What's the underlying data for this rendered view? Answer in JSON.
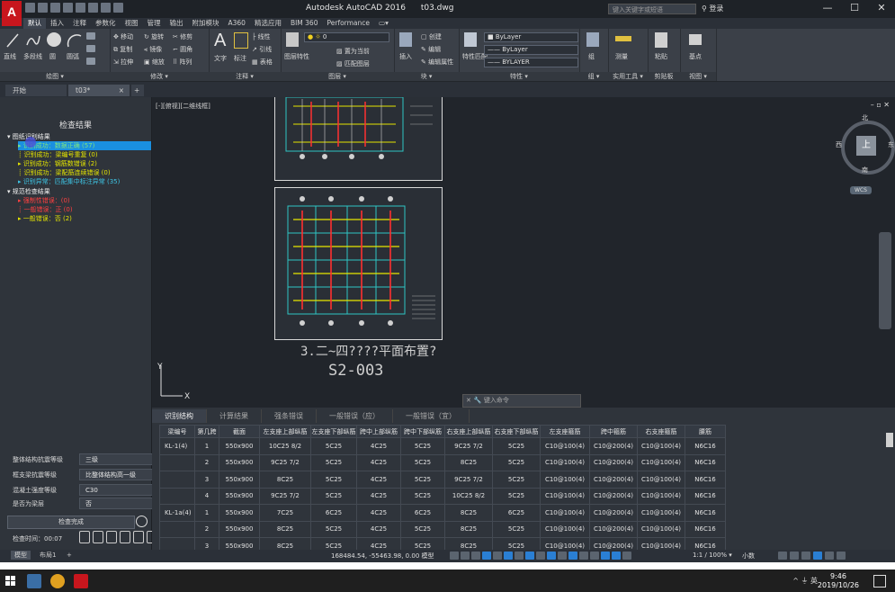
{
  "window": {
    "title": "Autodesk AutoCAD 2016",
    "filename": "t03.dwg",
    "search_placeholder": "键入关键字或短语",
    "signin": "登录",
    "min": "—",
    "max": "☐",
    "close": "✕"
  },
  "menu_tabs": [
    "默认",
    "插入",
    "注释",
    "参数化",
    "视图",
    "管理",
    "输出",
    "附加模块",
    "A360",
    "精选应用",
    "BIM 360",
    "Performance",
    "▭▾"
  ],
  "ribbon": {
    "panels": {
      "draw": "绘图 ▾",
      "modify": "修改 ▾",
      "annotation": "注释 ▾",
      "layers": "图层 ▾",
      "block": "块 ▾",
      "properties": "特性 ▾",
      "groups": "组 ▾",
      "utilities": "实用工具 ▾",
      "clipboard": "剪贴板",
      "view": "视图 ▾"
    },
    "tools": {
      "line": "直线",
      "polyline": "多段线",
      "circle": "圆",
      "arc": "圆弧",
      "move": "移动",
      "rotate": "旋转",
      "trim": "修剪",
      "copy": "复制",
      "mirror": "镜像",
      "fillet": "圆角",
      "stretch": "拉伸",
      "scale": "缩放",
      "array": "阵列",
      "text": "文字",
      "dimension": "标注",
      "linear": "线性",
      "leader": "引线",
      "table": "表格",
      "layer_props": "图层特性",
      "layer_current": "置为当前",
      "match_layer": "匹配图层",
      "insert": "插入",
      "create": "创建",
      "edit": "编辑",
      "edit_attr": "编辑属性",
      "match_props": "特性匹配",
      "group": "组",
      "measure": "测量",
      "paste": "粘贴",
      "base": "基点",
      "layer_value": "0"
    },
    "bylayer1": "ByLayer",
    "bylayer2": "ByLayer",
    "bylayer3": "BYLAYER"
  },
  "file_tabs": {
    "start": "开始",
    "current": "t03*",
    "close": "×",
    "add": "+"
  },
  "left_panel": {
    "title": "检查结果",
    "tree": [
      {
        "text": "▾ 图纸识别结果",
        "color": "#f0f0f0",
        "indent": 0
      },
      {
        "text": "▸ 识别成功：数据正确 (57)",
        "color": "#7fe37f",
        "indent": 1,
        "selected": true
      },
      {
        "text": "┊ 识别成功：梁编号重复 (0)",
        "color": "#e6e600",
        "indent": 1
      },
      {
        "text": "▸ 识别成功：钢筋数错误 (2)",
        "color": "#e6e600",
        "indent": 1
      },
      {
        "text": "┊ 识别成功：梁配筋连续错误 (0)",
        "color": "#e6e600",
        "indent": 1
      },
      {
        "text": "▸ 识别异常：匹配集中标注异常 (35)",
        "color": "#3ec6e6",
        "indent": 1
      },
      {
        "text": "▾ 规范检查结果",
        "color": "#f0f0f0",
        "indent": 0
      },
      {
        "text": "▸ 强制性错误：(0)",
        "color": "#ff4040",
        "indent": 1
      },
      {
        "text": "┊ 一般错误：正 (0)",
        "color": "#ff4040",
        "indent": 1
      },
      {
        "text": "▸ 一般错误：否 (2)",
        "color": "#e6e600",
        "indent": 1
      }
    ],
    "fields": [
      {
        "label": "整体结构抗震等级",
        "value": "三级"
      },
      {
        "label": "框支梁抗震等级",
        "value": "比整体结构高一级"
      },
      {
        "label": "混凝土强度等级",
        "value": "C30"
      },
      {
        "label": "是否为梁层",
        "value": "否"
      }
    ],
    "check_button": "检查完成",
    "check_time": "检查时间：00:07"
  },
  "drawing": {
    "view_label": "[-][俯视][二维线框]",
    "caption": "3.二~四????平面布置?",
    "code": "S2-003",
    "viewcube": {
      "north": "北",
      "south": "南",
      "east": "东",
      "west": "西",
      "top": "上"
    },
    "wcs": "WCS",
    "command_placeholder": "键入命令",
    "win_controls": "– ▫ ✕"
  },
  "results_table": {
    "tabs": [
      "识别结构",
      "计算结果",
      "强条错误",
      "一般错误（应）",
      "一般错误（宜）"
    ],
    "headers": [
      "梁编号",
      "第几跨",
      "截面",
      "左支座上部纵筋",
      "左支座下部纵筋",
      "跨中上部纵筋",
      "跨中下部纵筋",
      "右支座上部纵筋",
      "右支座下部纵筋",
      "左支座箍筋",
      "跨中箍筋",
      "右支座箍筋",
      "腰筋"
    ],
    "rows": [
      [
        "KL-1(4)",
        "1",
        "550x900",
        "10C25 8/2",
        "5C25",
        "4C25",
        "5C25",
        "9C25 7/2",
        "5C25",
        "C10@100(4)",
        "C10@200(4)",
        "C10@100(4)",
        "N6C16"
      ],
      [
        "",
        "2",
        "550x900",
        "9C25 7/2",
        "5C25",
        "4C25",
        "5C25",
        "8C25",
        "5C25",
        "C10@100(4)",
        "C10@200(4)",
        "C10@100(4)",
        "N6C16"
      ],
      [
        "",
        "3",
        "550x900",
        "8C25",
        "5C25",
        "4C25",
        "5C25",
        "9C25 7/2",
        "5C25",
        "C10@100(4)",
        "C10@200(4)",
        "C10@100(4)",
        "N6C16"
      ],
      [
        "",
        "4",
        "550x900",
        "9C25 7/2",
        "5C25",
        "4C25",
        "5C25",
        "10C25 8/2",
        "5C25",
        "C10@100(4)",
        "C10@200(4)",
        "C10@100(4)",
        "N6C16"
      ],
      [
        "KL-1a(4)",
        "1",
        "550x900",
        "7C25",
        "6C25",
        "4C25",
        "6C25",
        "8C25",
        "6C25",
        "C10@100(4)",
        "C10@200(4)",
        "C10@100(4)",
        "N6C16"
      ],
      [
        "",
        "2",
        "550x900",
        "8C25",
        "5C25",
        "4C25",
        "5C25",
        "8C25",
        "5C25",
        "C10@100(4)",
        "C10@200(4)",
        "C10@100(4)",
        "N6C16"
      ],
      [
        "",
        "3",
        "550x900",
        "8C25",
        "5C25",
        "4C25",
        "5C25",
        "8C25",
        "5C25",
        "C10@100(4)",
        "C10@200(4)",
        "C10@100(4)",
        "N6C16"
      ]
    ]
  },
  "layout_tabs": [
    "模型",
    "布局1",
    "+"
  ],
  "status": {
    "coords": "168484.54, -55463.98, 0.00",
    "model": "模型",
    "scale": "1:1 / 100% ▾",
    "decimal": "小数"
  },
  "taskbar": {
    "time": "9:46",
    "date": "2019/10/26",
    "tray": "^ ⏚ 英"
  }
}
